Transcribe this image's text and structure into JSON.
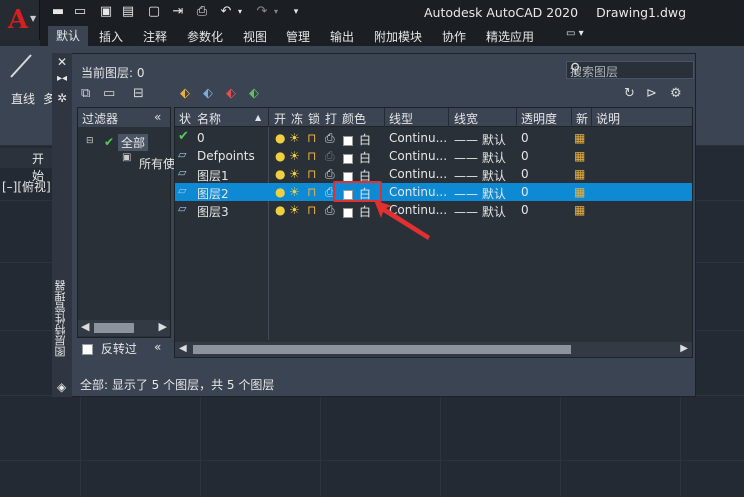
{
  "title": {
    "app": "Autodesk AutoCAD 2020",
    "file": "Drawing1.dwg"
  },
  "ribbon_tabs": [
    "默认",
    "插入",
    "注释",
    "参数化",
    "视图",
    "管理",
    "输出",
    "附加模块",
    "协作",
    "精选应用"
  ],
  "ribbon": {
    "line_label": "直线",
    "second_label": "多"
  },
  "doc_tab": "开始",
  "viewport_label": "[–][俯视]",
  "layer_manager": {
    "current_layer": "当前图层: 0",
    "search_placeholder": "搜索图层",
    "side_title": "图层特性管理器",
    "filter_header": "过滤器",
    "tree": {
      "all": "全部",
      "used": "所有使"
    },
    "invert": "反转过",
    "columns": [
      "状",
      "名称",
      "开",
      "冻",
      "锁",
      "打",
      "颜色",
      "线型",
      "线宽",
      "透明度",
      "新",
      "说明"
    ],
    "layers": [
      {
        "name": "0",
        "color": "白",
        "linetype": "Continu...",
        "lineweight": "—— 默认",
        "transparency": "0",
        "current": true
      },
      {
        "name": "Defpoints",
        "color": "白",
        "linetype": "Continu...",
        "lineweight": "—— 默认",
        "transparency": "0",
        "current": false
      },
      {
        "name": "图层1",
        "color": "白",
        "linetype": "Continu...",
        "lineweight": "—— 默认",
        "transparency": "0",
        "current": false
      },
      {
        "name": "图层2",
        "color": "白",
        "linetype": "Continu...",
        "lineweight": "—— 默认",
        "transparency": "0",
        "current": false,
        "selected": true
      },
      {
        "name": "图层3",
        "color": "白",
        "linetype": "Continu...",
        "lineweight": "—— 默认",
        "transparency": "0",
        "current": false
      }
    ],
    "status": "全部: 显示了 5 个图层，共 5 个图层"
  },
  "colors": {
    "selection": "#0e8ad4",
    "annotation": "#e03030"
  }
}
